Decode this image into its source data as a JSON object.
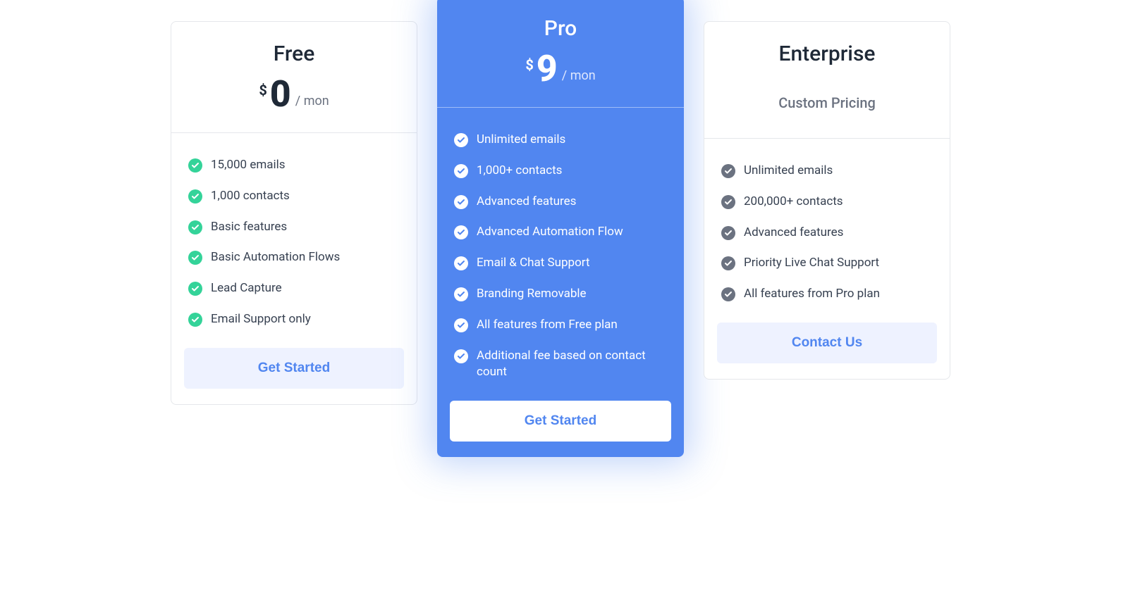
{
  "pricing": {
    "plans": [
      {
        "name": "Free",
        "currency": "$",
        "amount": "0",
        "period": "/ mon",
        "custom_label": "",
        "cta": "Get Started",
        "check_style": "green",
        "highlight": false,
        "features": [
          "15,000 emails",
          "1,000 contacts",
          "Basic features",
          "Basic Automation Flows",
          "Lead Capture",
          "Email Support only"
        ]
      },
      {
        "name": "Pro",
        "currency": "$",
        "amount": "9",
        "period": "/ mon",
        "custom_label": "",
        "cta": "Get Started",
        "check_style": "white",
        "highlight": true,
        "features": [
          "Unlimited emails",
          "1,000+ contacts",
          "Advanced features",
          "Advanced Automation Flow",
          "Email & Chat Support",
          "Branding Removable",
          "All features from Free plan",
          "Additional fee based on contact count"
        ]
      },
      {
        "name": "Enterprise",
        "currency": "",
        "amount": "",
        "period": "",
        "custom_label": "Custom Pricing",
        "cta": "Contact Us",
        "check_style": "gray",
        "highlight": false,
        "features": [
          "Unlimited emails",
          "200,000+ contacts",
          "Advanced features",
          "Priority Live Chat Support",
          "All features from Pro plan"
        ]
      }
    ]
  }
}
